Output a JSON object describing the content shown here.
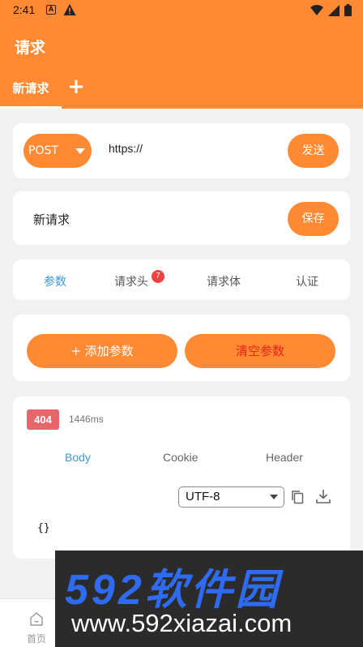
{
  "status_bar": {
    "time": "2:41",
    "notif_a": "A"
  },
  "app_bar": {
    "title": "请求"
  },
  "request_tabs": {
    "active_tab": "新请求",
    "add_label": "+"
  },
  "request_line": {
    "method": "POST",
    "url": "https://",
    "send_label": "发送"
  },
  "request_name": {
    "name": "新请求",
    "save_label": "保存"
  },
  "param_tabs": [
    {
      "label": "参数",
      "active": true
    },
    {
      "label": "请求头",
      "badge": "7"
    },
    {
      "label": "请求体"
    },
    {
      "label": "认证"
    }
  ],
  "param_actions": {
    "add_label": "+ 添加参数",
    "clear_label": "清空参数"
  },
  "response": {
    "status_code": "404",
    "duration": "1446ms",
    "tabs": [
      {
        "label": "Body",
        "active": true
      },
      {
        "label": "Cookie"
      },
      {
        "label": "Header"
      }
    ],
    "encoding": "UTF-8",
    "body": "{}"
  },
  "bottom_nav": {
    "home_label": "首页"
  },
  "watermark": {
    "logo_text": "592软件园",
    "url_text": "www.592xiazai.com"
  },
  "colors": {
    "accent": "#ff8a33",
    "link": "#3a9be0",
    "error": "#e5676b",
    "danger_text": "#e8231e"
  },
  "icons": [
    "warning-icon",
    "wifi-icon",
    "signal-icon",
    "battery-icon",
    "copy-icon",
    "download-icon",
    "home-icon"
  ]
}
